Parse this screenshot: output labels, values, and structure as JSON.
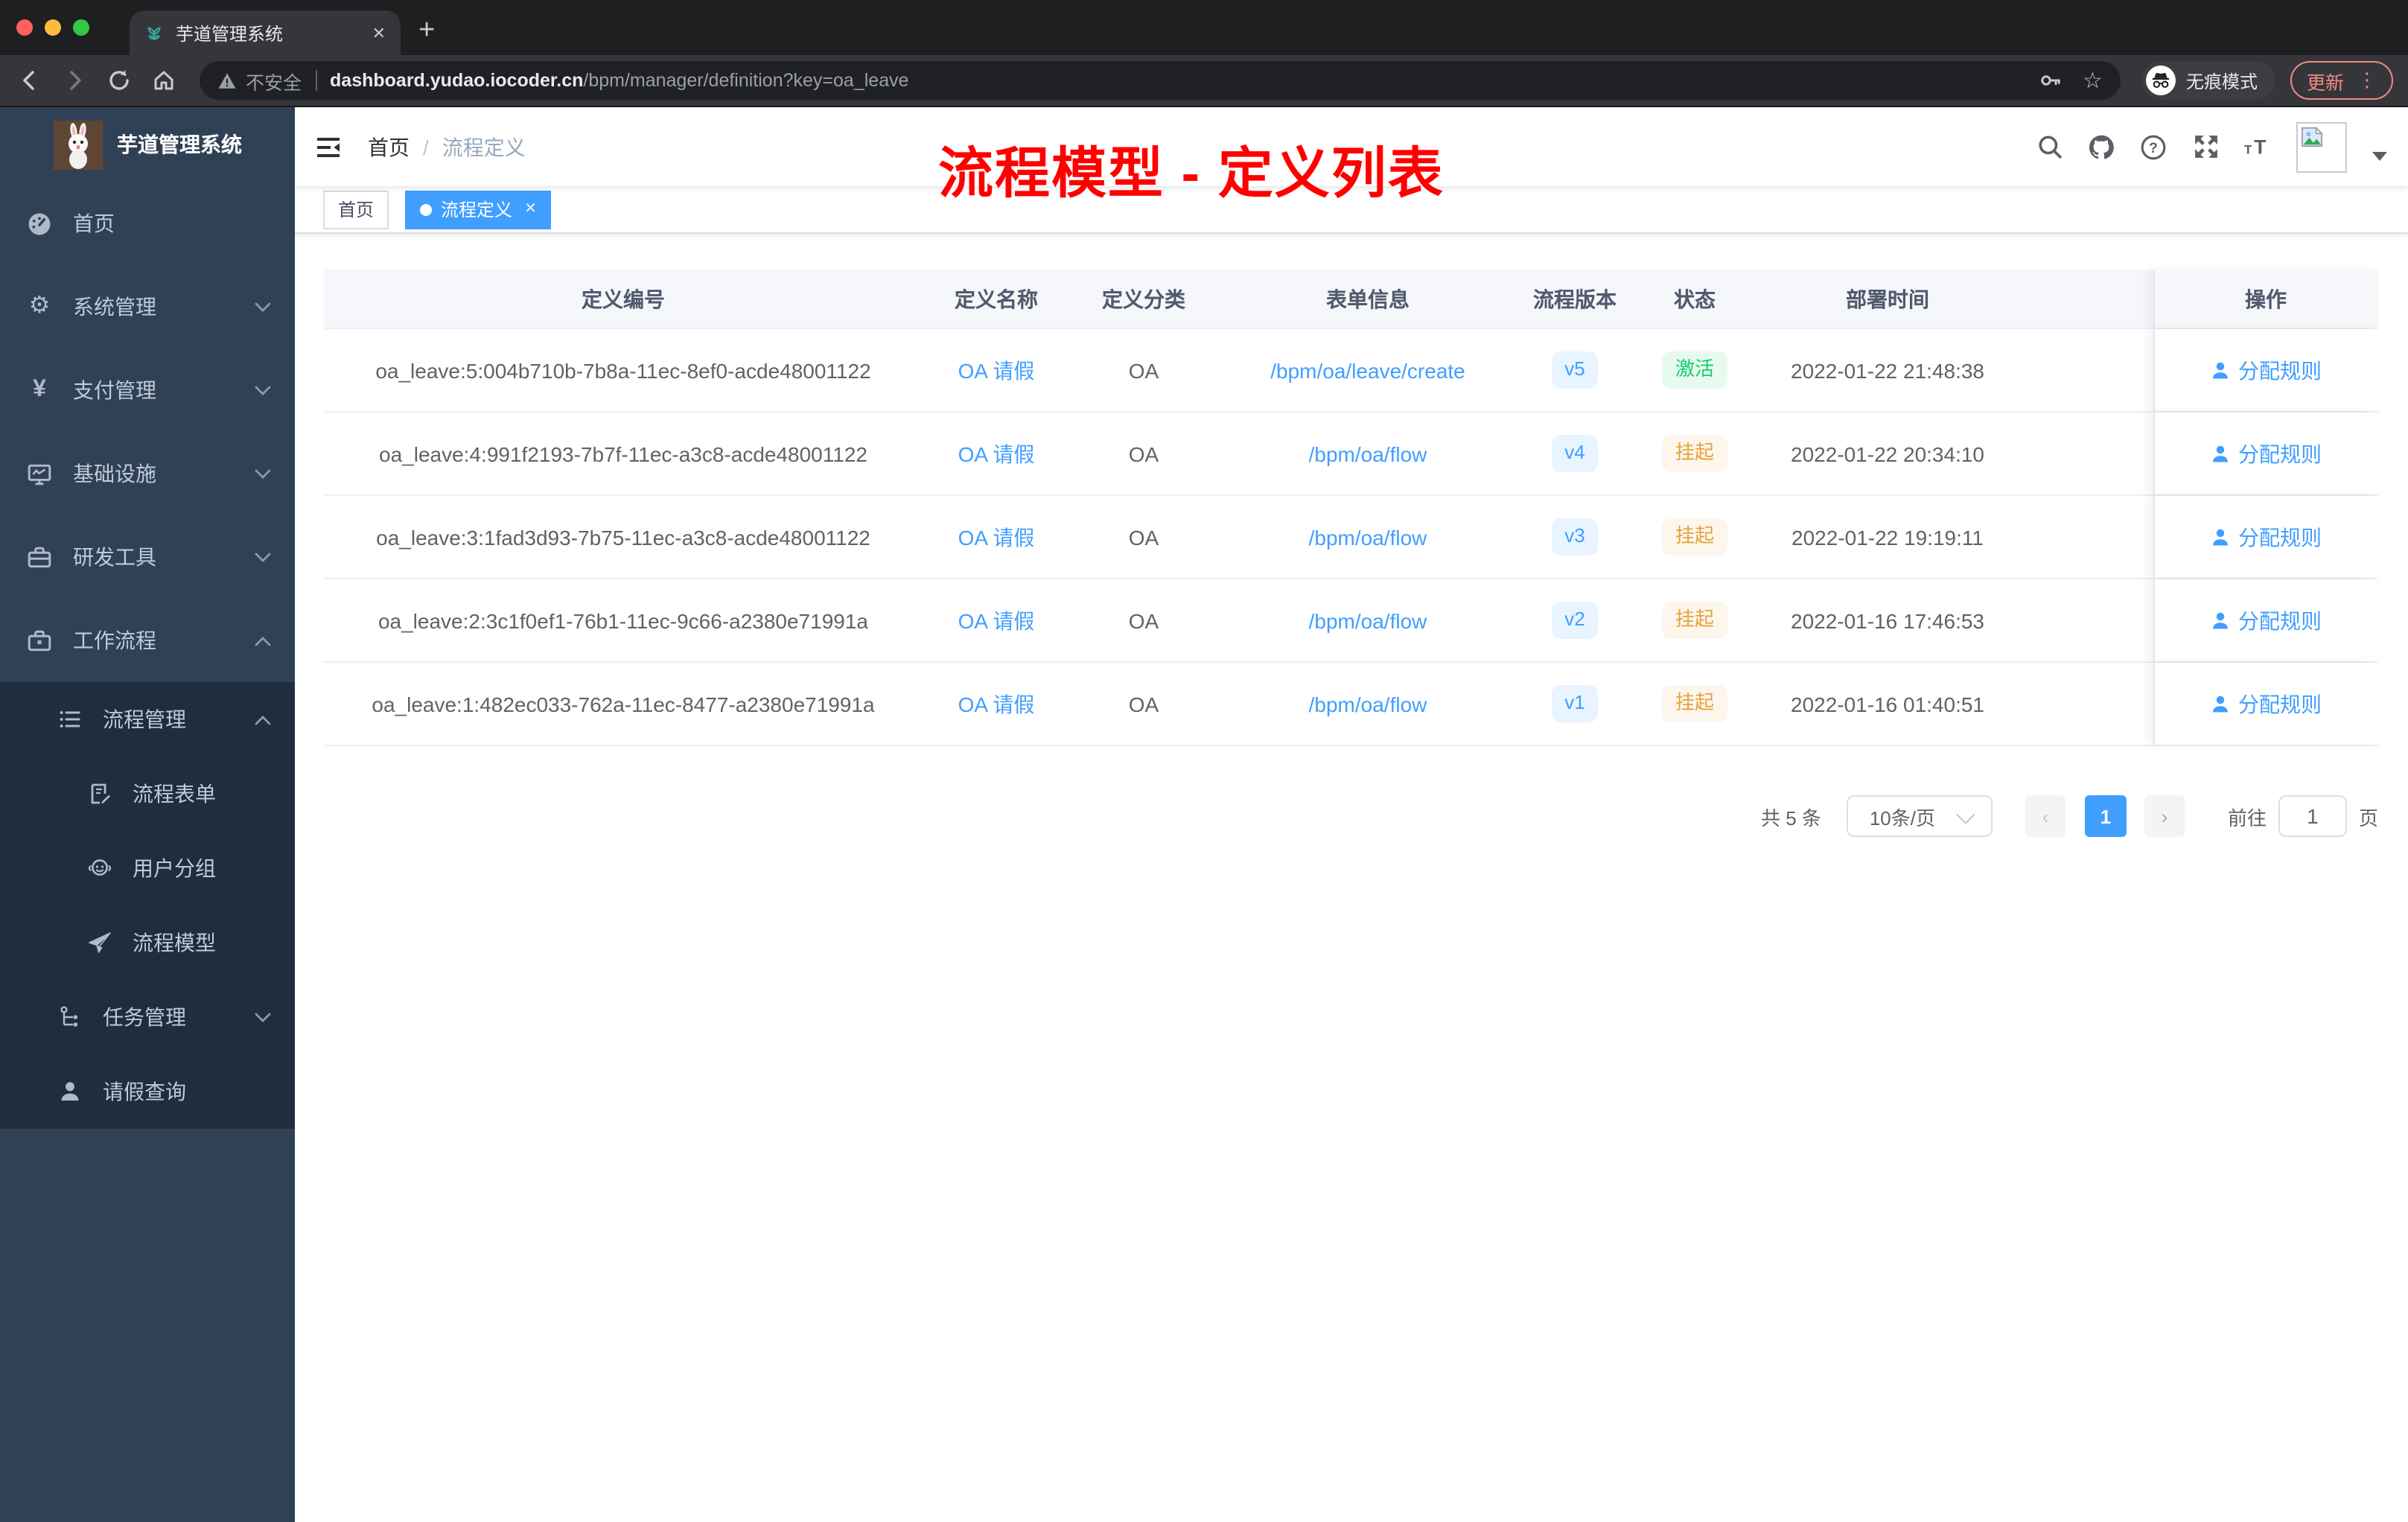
{
  "chrome": {
    "tab_title": "芋道管理系统",
    "tab_close": "✕",
    "new_tab": "+",
    "insecure_label": "不安全",
    "url_domain": "dashboard.yudao.iocoder.cn",
    "url_path": "/bpm/manager/definition?key=oa_leave",
    "incognito_label": "无痕模式",
    "update_label": "更新",
    "menu_dots": "⋮",
    "star_icon": "☆"
  },
  "sidebar": {
    "logo_title": "芋道管理系统",
    "items": [
      {
        "label": "首页",
        "icon": "dashboard-icon",
        "expandable": false
      },
      {
        "label": "系统管理",
        "icon": "gear-icon",
        "expandable": true,
        "expanded": false
      },
      {
        "label": "支付管理",
        "icon": "yen-icon",
        "expandable": true,
        "expanded": false
      },
      {
        "label": "基础设施",
        "icon": "monitor-icon",
        "expandable": true,
        "expanded": false
      },
      {
        "label": "研发工具",
        "icon": "toolbox-icon",
        "expandable": true,
        "expanded": false
      },
      {
        "label": "工作流程",
        "icon": "workflow-icon",
        "expandable": true,
        "expanded": true
      }
    ],
    "submenu": {
      "process_manage": {
        "label": "流程管理",
        "icon": "list-icon",
        "expanded": true
      },
      "children": [
        {
          "label": "流程表单",
          "icon": "form-icon"
        },
        {
          "label": "用户分组",
          "icon": "user-group-icon"
        },
        {
          "label": "流程模型",
          "icon": "paper-plane-icon"
        }
      ],
      "task_manage": {
        "label": "任务管理",
        "icon": "task-tree-icon",
        "expanded": false
      },
      "leave_query": {
        "label": "请假查询",
        "icon": "person-icon"
      }
    },
    "colors": {
      "bg": "#304156",
      "submenu_bg": "#1f2d3d",
      "text": "#bfcbd9"
    }
  },
  "navbar": {
    "breadcrumb": {
      "home": "首页",
      "sep": "/",
      "current": "流程定义"
    },
    "annotation": "流程模型 - 定义列表",
    "annotation_color": "#ff0000"
  },
  "tags": {
    "home": {
      "label": "首页",
      "active": false
    },
    "current": {
      "label": "流程定义",
      "active": true,
      "close": "✕"
    }
  },
  "table": {
    "columns": [
      "定义编号",
      "定义名称",
      "定义分类",
      "表单信息",
      "流程版本",
      "状态",
      "部署时间",
      "操作"
    ],
    "action_label": "分配规则",
    "rows": [
      {
        "id": "oa_leave:5:004b710b-7b8a-11ec-8ef0-acde48001122",
        "name": "OA 请假",
        "category": "OA",
        "form": "/bpm/oa/leave/create",
        "version": "v5",
        "status": "激活",
        "status_type": "success",
        "deploy_time": "2022-01-22 21:48:38"
      },
      {
        "id": "oa_leave:4:991f2193-7b7f-11ec-a3c8-acde48001122",
        "name": "OA 请假",
        "category": "OA",
        "form": "/bpm/oa/flow",
        "version": "v4",
        "status": "挂起",
        "status_type": "warning",
        "deploy_time": "2022-01-22 20:34:10"
      },
      {
        "id": "oa_leave:3:1fad3d93-7b75-11ec-a3c8-acde48001122",
        "name": "OA 请假",
        "category": "OA",
        "form": "/bpm/oa/flow",
        "version": "v3",
        "status": "挂起",
        "status_type": "warning",
        "deploy_time": "2022-01-22 19:19:11"
      },
      {
        "id": "oa_leave:2:3c1f0ef1-76b1-11ec-9c66-a2380e71991a",
        "name": "OA 请假",
        "category": "OA",
        "form": "/bpm/oa/flow",
        "version": "v2",
        "status": "挂起",
        "status_type": "warning",
        "deploy_time": "2022-01-16 17:46:53"
      },
      {
        "id": "oa_leave:1:482ec033-762a-11ec-8477-a2380e71991a",
        "name": "OA 请假",
        "category": "OA",
        "form": "/bpm/oa/flow",
        "version": "v1",
        "status": "挂起",
        "status_type": "warning",
        "deploy_time": "2022-01-16 01:40:51"
      }
    ],
    "status_colors": {
      "success_text": "#13ce66",
      "success_bg": "#e7faf0",
      "warning_text": "#e6a23c",
      "warning_bg": "#fdf6ec",
      "version_text": "#409eff",
      "version_bg": "#e8f4ff"
    }
  },
  "pagination": {
    "total_label": "共 5 条",
    "page_size": "10条/页",
    "prev": "‹",
    "current_page": "1",
    "next": "›",
    "goto_label": "前往",
    "goto_value": "1",
    "page_label": "页"
  }
}
